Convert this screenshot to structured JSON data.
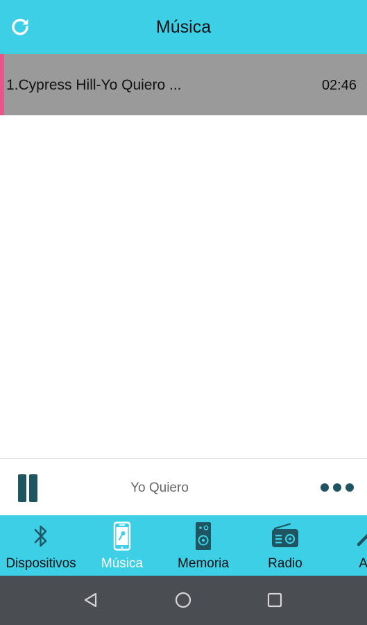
{
  "header": {
    "title": "Música",
    "refresh_icon": "refresh-icon"
  },
  "tracks": [
    {
      "title": "1.Cypress Hill-Yo Quiero ...",
      "duration": "02:46",
      "active": true
    }
  ],
  "player": {
    "now_playing": "Yo Quiero",
    "state": "playing",
    "pause_icon": "pause-icon",
    "more_icon": "more-icon"
  },
  "tabs": [
    {
      "label": "Dispositivos",
      "icon": "bluetooth-icon",
      "active": false
    },
    {
      "label": "Música",
      "icon": "phone-music-icon",
      "active": true
    },
    {
      "label": "Memoria",
      "icon": "speaker-icon",
      "active": false
    },
    {
      "label": "Radio",
      "icon": "radio-icon",
      "active": false
    },
    {
      "label": "Au",
      "icon": "microphone-icon",
      "active": false
    }
  ],
  "system_nav": {
    "back_icon": "back-icon",
    "home_icon": "home-icon",
    "recents_icon": "recents-icon"
  },
  "colors": {
    "accent": "#3ccfe6",
    "active_indicator": "#e8558a",
    "selected_row": "#9a9a9a",
    "player_icons": "#1f5461",
    "system_nav": "#4a4e52"
  }
}
